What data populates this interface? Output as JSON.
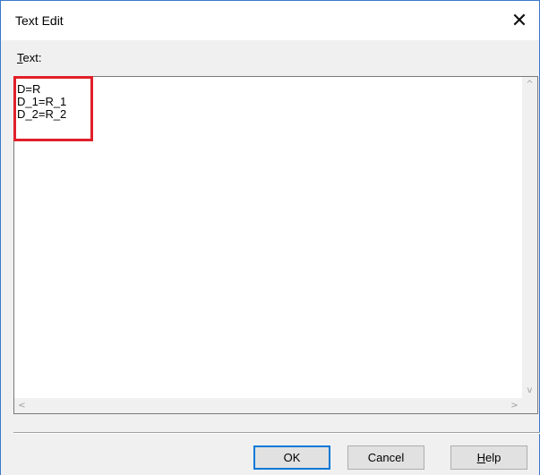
{
  "dialog": {
    "title": "Text Edit",
    "close_glyph": "✕"
  },
  "field": {
    "label_prefix": "T",
    "label_rest": "ext:",
    "value": "D=R\nD_1=R_1\nD_2=R_2"
  },
  "scrollbars": {
    "up": "^",
    "down": "v",
    "left": "<",
    "right": ">"
  },
  "buttons": {
    "ok": "OK",
    "cancel": "Cancel",
    "help_prefix": "H",
    "help_rest": "elp"
  },
  "icons": {
    "close": "close-icon",
    "scroll_up": "chevron-up-icon",
    "scroll_down": "chevron-down-icon",
    "scroll_left": "chevron-left-icon",
    "scroll_right": "chevron-right-icon"
  },
  "colors": {
    "highlight": "#e0202a",
    "default_button_border": "#0078d7"
  }
}
